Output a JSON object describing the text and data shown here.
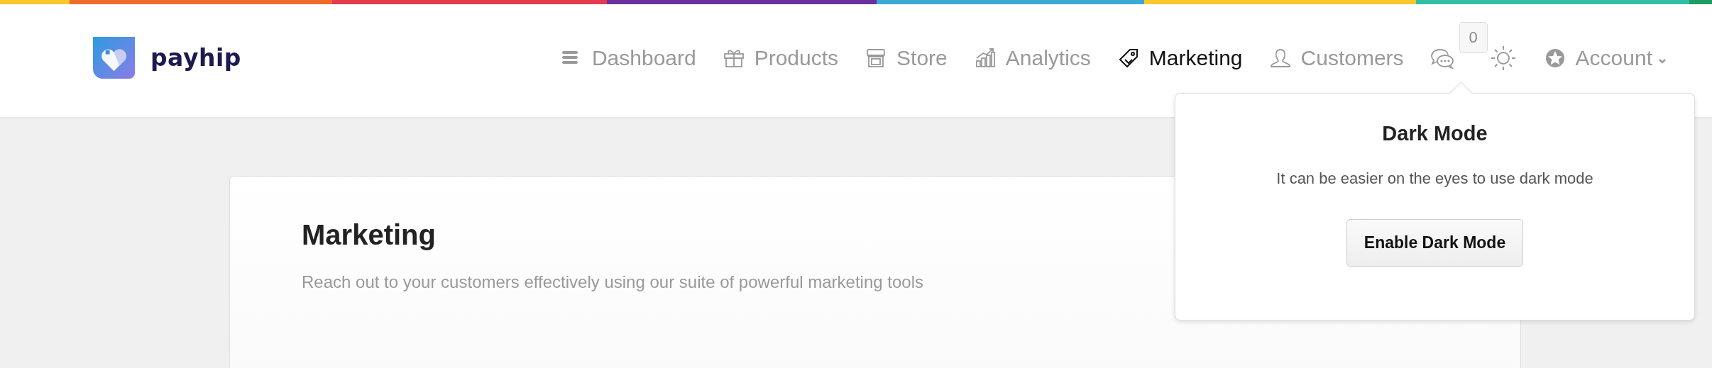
{
  "logo": {
    "text": "payhip"
  },
  "nav": [
    {
      "kind": "link",
      "label": "Dashboard",
      "selected": false
    },
    {
      "kind": "link",
      "label": "Products",
      "selected": false
    },
    {
      "kind": "link",
      "label": "Store",
      "selected": false
    },
    {
      "kind": "link",
      "label": "Analytics",
      "selected": false
    },
    {
      "kind": "link",
      "label": "Marketing",
      "selected": true
    },
    {
      "kind": "link",
      "label": "Customers",
      "selected": false
    },
    {
      "kind": "messages",
      "count": "0"
    },
    {
      "kind": "theme"
    },
    {
      "kind": "link",
      "label": "Account",
      "selected": false,
      "dropdown": true
    }
  ],
  "dark_mode_popover": {
    "title": "Dark Mode",
    "text": "It can be easier on the eyes to use dark mode",
    "button": "Enable Dark Mode"
  },
  "page": {
    "title": "Marketing",
    "subtitle": "Reach out to your customers effectively using our suite of powerful marketing tools"
  }
}
